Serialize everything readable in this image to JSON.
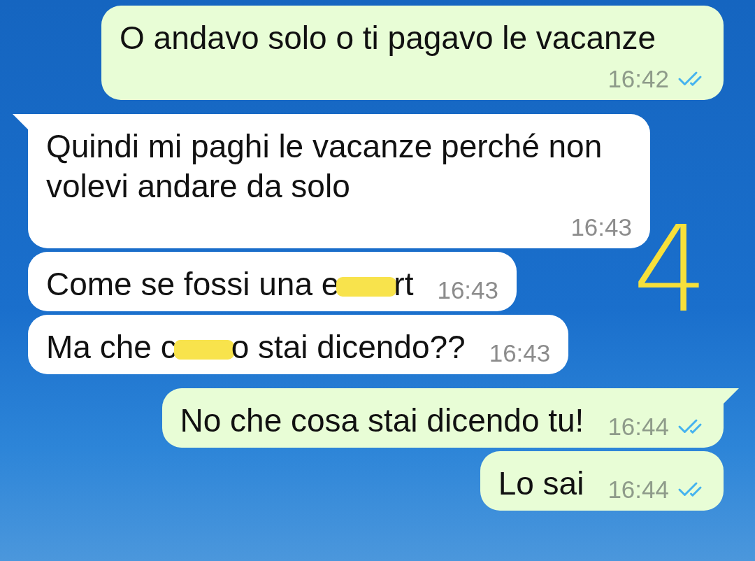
{
  "messages": [
    {
      "kind": "outgoing",
      "tail": false,
      "parts": [
        {
          "kind": "text",
          "text": "O andavo solo o ti pagavo le vacanze"
        }
      ],
      "time": "16:42",
      "read": true
    },
    {
      "kind": "incoming",
      "tail": true,
      "parts": [
        {
          "kind": "text",
          "text": "Quindi mi paghi le vacanze perché non volevi andare da solo"
        }
      ],
      "time": "16:43"
    },
    {
      "kind": "incoming",
      "tail": false,
      "parts": [
        {
          "kind": "text",
          "text": "Come se fossi una e"
        },
        {
          "kind": "redacted"
        },
        {
          "kind": "text",
          "text": "rt"
        }
      ],
      "time": "16:43"
    },
    {
      "kind": "incoming",
      "tail": false,
      "parts": [
        {
          "kind": "text",
          "text": "Ma che c"
        },
        {
          "kind": "redacted"
        },
        {
          "kind": "text",
          "text": "o stai dicendo??"
        }
      ],
      "time": "16:43"
    },
    {
      "kind": "outgoing",
      "tail": true,
      "parts": [
        {
          "kind": "text",
          "text": "No che cosa stai dicendo tu!"
        }
      ],
      "time": "16:44",
      "read": true
    },
    {
      "kind": "outgoing",
      "tail": false,
      "parts": [
        {
          "kind": "text",
          "text": "Lo sai"
        }
      ],
      "time": "16:44",
      "read": true
    }
  ],
  "annotation": {
    "text": "4"
  }
}
